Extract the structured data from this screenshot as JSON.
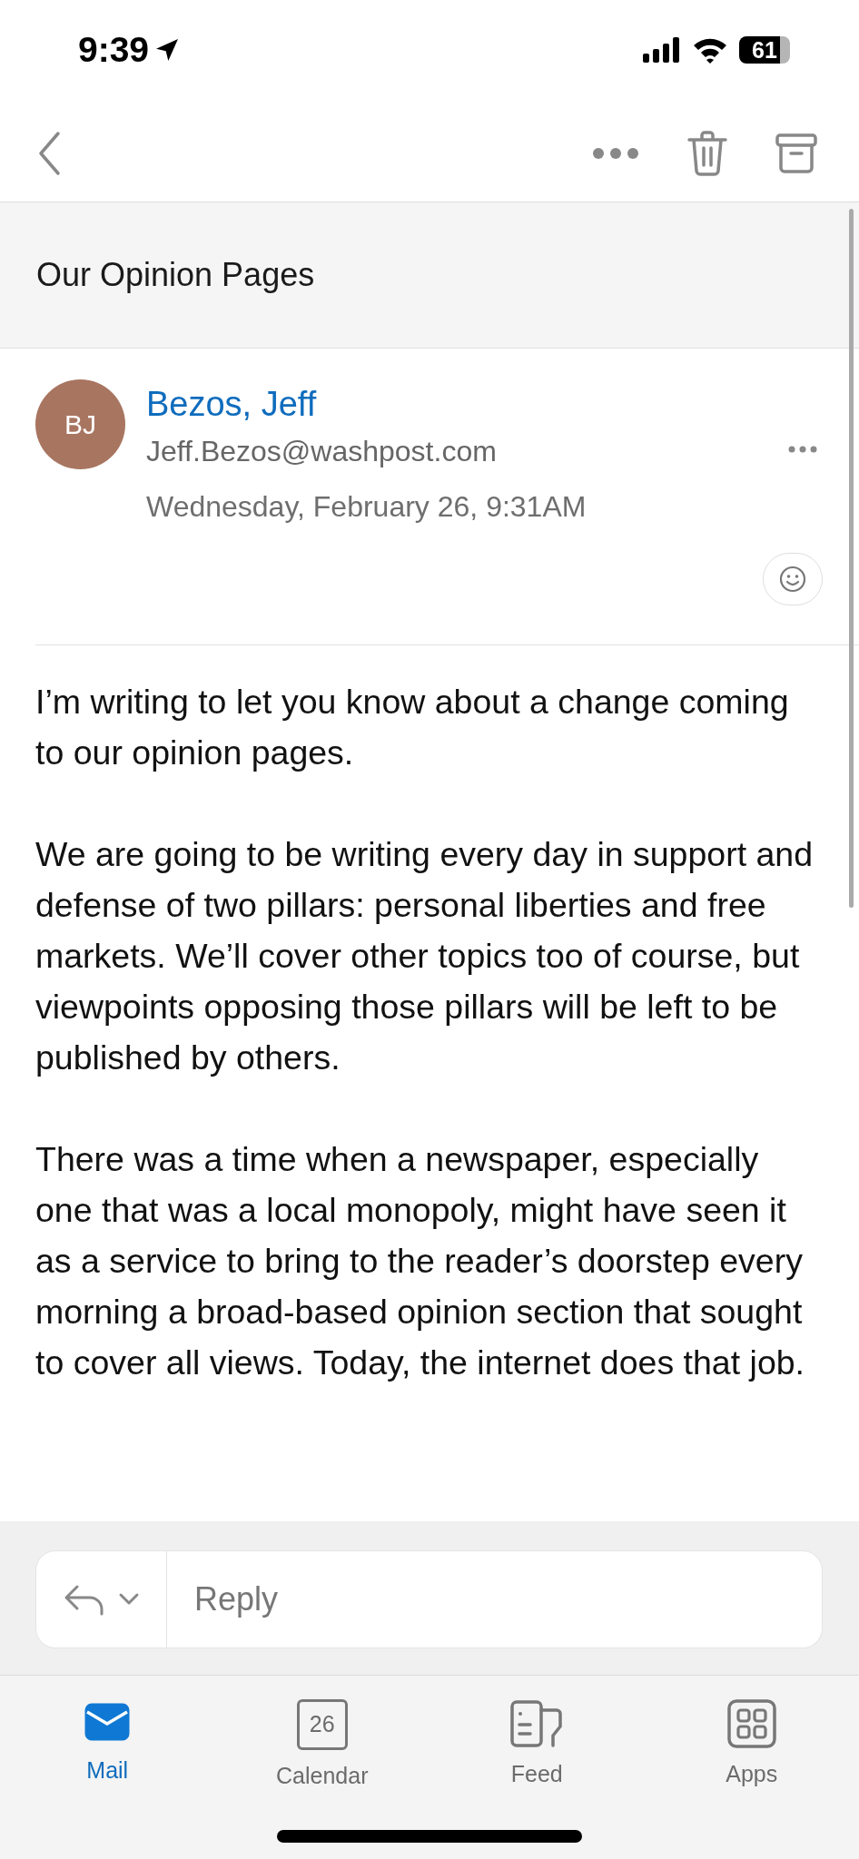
{
  "status_bar": {
    "time": "9:39",
    "battery": "61"
  },
  "subject": "Our Opinion Pages",
  "sender": {
    "initials": "BJ",
    "name": "Bezos, Jeff",
    "email": "Jeff.Bezos@washpost.com",
    "date": "Wednesday, February 26, 9:31AM"
  },
  "body": [
    "I’m writing to let you know about a change coming to our opinion pages.",
    "We are going to be writing every day in support and defense of two pillars: personal liberties and free markets. We’ll cover other topics too of course, but viewpoints opposing those pillars will be left to be published by others.",
    "There was a time when a newspaper, especially one that was a local monopoly, might have seen it as a service to bring to the reader’s doorstep every morning a broad-based opinion section that sought to cover all views. Today, the internet does that job."
  ],
  "reply": {
    "placeholder": "Reply"
  },
  "tabs": [
    {
      "kind": "mail",
      "label": "Mail",
      "selected": true
    },
    {
      "kind": "calendar",
      "label": "Calendar",
      "badge": "26",
      "selected": false
    },
    {
      "kind": "feed",
      "label": "Feed",
      "selected": false
    },
    {
      "kind": "apps",
      "label": "Apps",
      "selected": false
    }
  ]
}
